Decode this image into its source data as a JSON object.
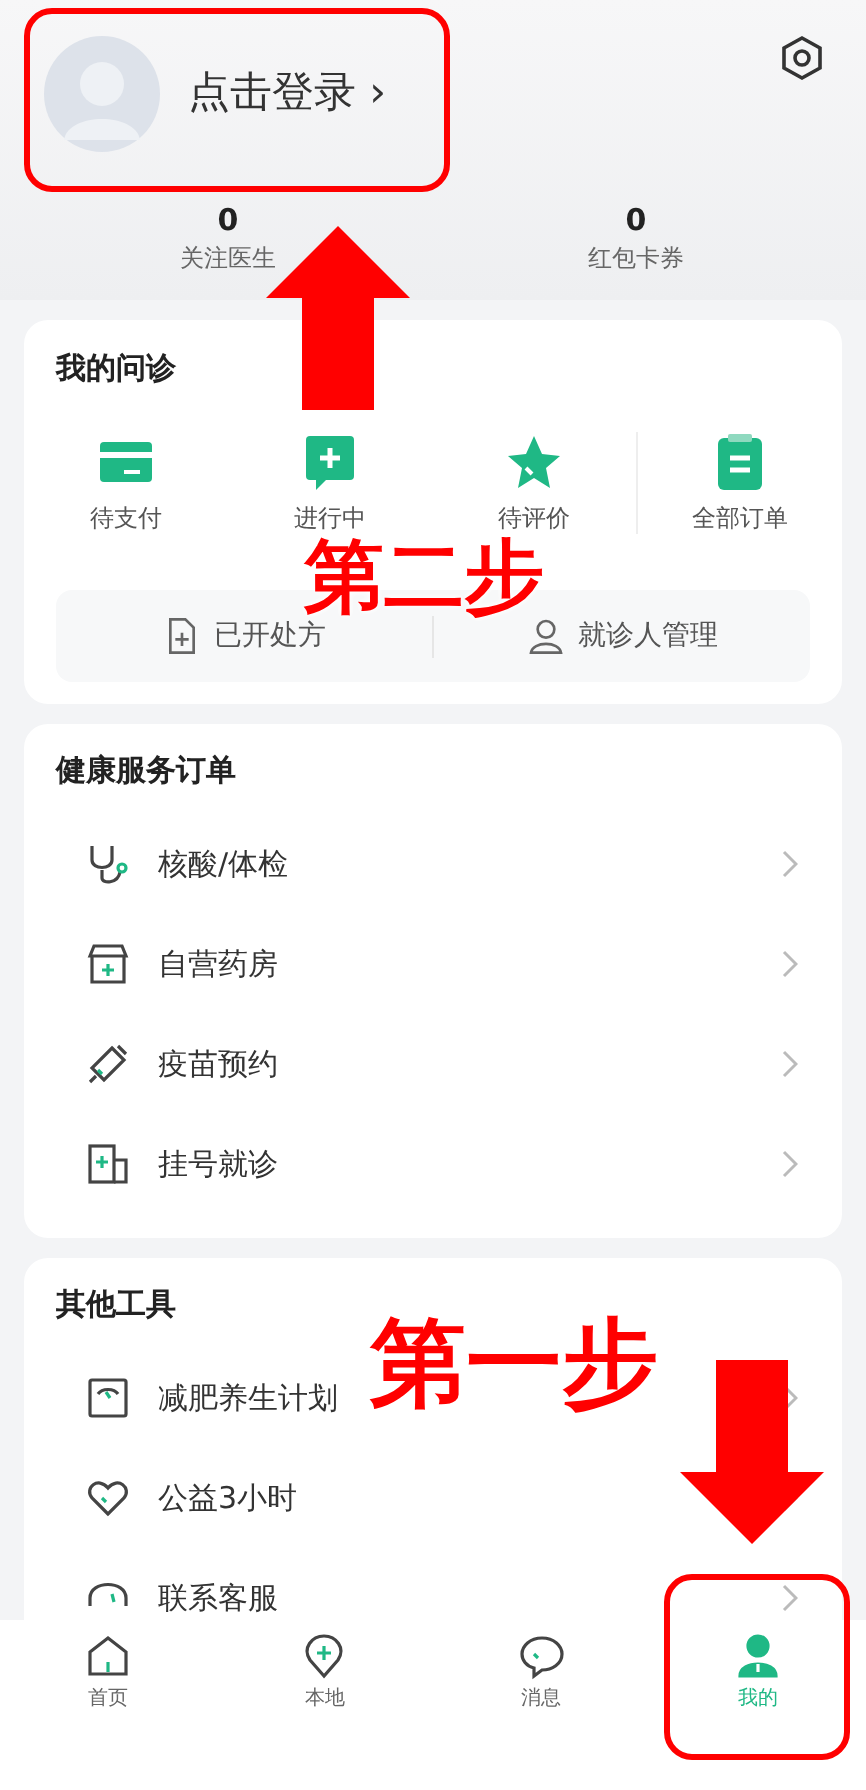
{
  "profile": {
    "login": "点击登录 ›",
    "stats": [
      {
        "value": "0",
        "label": "关注医生"
      },
      {
        "value": "0",
        "label": "红包卡券"
      }
    ]
  },
  "consult": {
    "title": "我的问诊",
    "items": [
      {
        "kind": "card",
        "label": "待支付"
      },
      {
        "kind": "chat",
        "label": "进行中"
      },
      {
        "kind": "star",
        "label": "待评价"
      },
      {
        "kind": "clipboard",
        "label": "全部订单"
      }
    ],
    "links": [
      {
        "kind": "prescription",
        "label": "已开处方"
      },
      {
        "kind": "person",
        "label": "就诊人管理"
      }
    ]
  },
  "services": {
    "title": "健康服务订单",
    "items": [
      {
        "kind": "stethoscope",
        "label": "核酸/体检"
      },
      {
        "kind": "store",
        "label": "自营药房"
      },
      {
        "kind": "syringe",
        "label": "疫苗预约"
      },
      {
        "kind": "register",
        "label": "挂号就诊"
      }
    ]
  },
  "tools": {
    "title": "其他工具",
    "items": [
      {
        "kind": "scale",
        "label": "减肥养生计划"
      },
      {
        "kind": "heart",
        "label": "公益3小时"
      },
      {
        "kind": "headset",
        "label": "联系客服"
      }
    ]
  },
  "nav": [
    {
      "kind": "home",
      "label": "首页",
      "selected": false
    },
    {
      "kind": "local",
      "label": "本地",
      "selected": false
    },
    {
      "kind": "message",
      "label": "消息",
      "selected": false
    },
    {
      "kind": "mine",
      "label": "我的",
      "selected": true
    }
  ],
  "annotations": [
    "第二步",
    "第一步"
  ]
}
